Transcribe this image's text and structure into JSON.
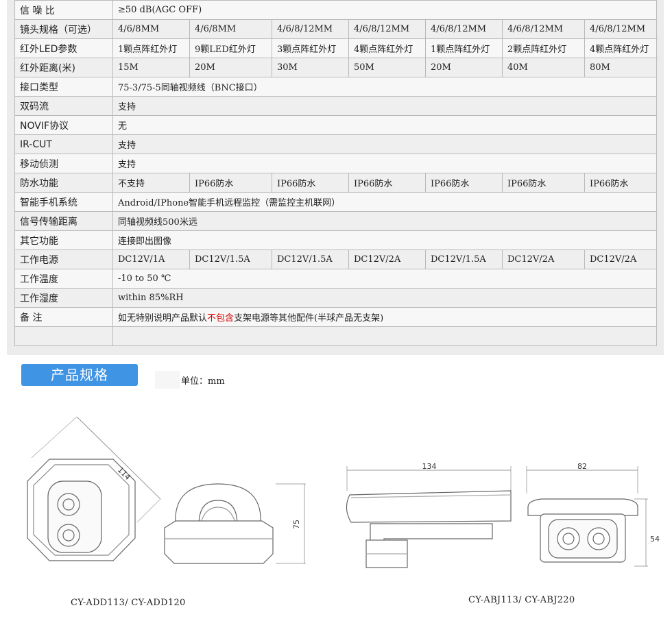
{
  "spec_table": {
    "rows": [
      {
        "label": "信 噪 比",
        "values": [
          "≥50 dB(AGC OFF)"
        ]
      },
      {
        "label": "镜头规格（可选）",
        "values": [
          "4/6/8MM",
          "4/6/8MM",
          "4/6/8/12MM",
          "4/6/8/12MM",
          "4/6/8/12MM",
          "4/6/8/12MM",
          "4/6/8/12MM"
        ]
      },
      {
        "label": "红外LED参数",
        "values": [
          "1颗点阵红外灯",
          "9颗LED红外灯",
          "3颗点阵红外灯",
          "4颗点阵红外灯",
          "1颗点阵红外灯",
          "2颗点阵红外灯",
          "4颗点阵红外灯"
        ]
      },
      {
        "label": "红外距离(米)",
        "values": [
          "15M",
          "20M",
          "30M",
          "50M",
          "20M",
          "40M",
          "80M"
        ]
      },
      {
        "label": "接口类型",
        "values": [
          "75-3/75-5同轴视频线（BNC接口）"
        ]
      },
      {
        "label": "双码流",
        "values": [
          "支持"
        ]
      },
      {
        "label": "NOVIF协议",
        "values": [
          "无"
        ]
      },
      {
        "label": "IR-CUT",
        "values": [
          "支持"
        ]
      },
      {
        "label": "移动侦测",
        "values": [
          "支持"
        ]
      },
      {
        "label": "防水功能",
        "values": [
          "不支持",
          "IP66防水",
          "IP66防水",
          "IP66防水",
          "IP66防水",
          "IP66防水",
          "IP66防水"
        ]
      },
      {
        "label": "智能手机系统",
        "values": [
          "Android/IPhone智能手机远程监控（需监控主机联网）"
        ]
      },
      {
        "label": "信号传输距离",
        "values": [
          "同轴视频线500米远"
        ]
      },
      {
        "label": "其它功能",
        "values": [
          "连接即出图像"
        ]
      },
      {
        "label": "工作电源",
        "values": [
          "DC12V/1A",
          "DC12V/1.5A",
          "DC12V/1.5A",
          "DC12V/2A",
          "DC12V/1.5A",
          "DC12V/2A",
          "DC12V/2A"
        ]
      },
      {
        "label": "工作温度",
        "values": [
          "-10 to 50 ℃"
        ]
      },
      {
        "label": "工作湿度",
        "values": [
          "within 85%RH"
        ]
      },
      {
        "label": "备 注",
        "values": [
          "如无特别说明产品默认",
          "不包含",
          "支架电源等其他配件(半球产品无支架)"
        ]
      },
      {
        "label": "",
        "values": [
          ""
        ]
      }
    ]
  },
  "section": {
    "title": "产品规格",
    "unit": "单位：mm"
  },
  "drawings": {
    "dome_dim_diag": "114",
    "dome_dim_height": "75",
    "bullet_dim_length": "134",
    "bullet_dim_width": "82",
    "bullet_dim_height": "54",
    "model_left": "CY-ADD113/ CY-ADD120",
    "model_right": "CY-ABJ113/ CY-ABJ220"
  },
  "colors": {
    "title_bar": "#3f94e4",
    "highlight": "#d40000"
  }
}
